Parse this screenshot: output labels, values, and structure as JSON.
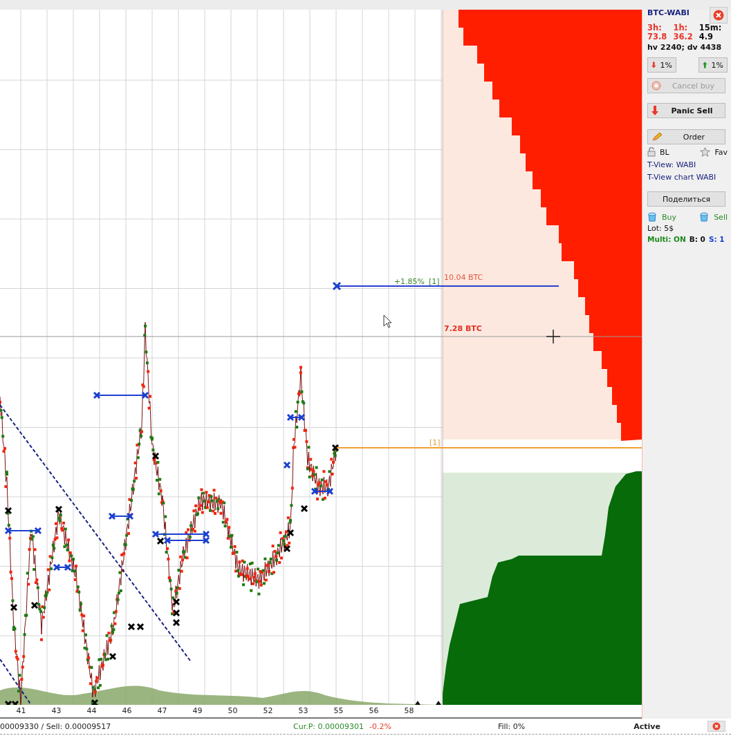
{
  "chart": {
    "x_labels": [
      "41",
      "43",
      "44",
      "46",
      "47",
      "49",
      "50",
      "52",
      "53",
      "55",
      "56",
      "58"
    ],
    "order_gain": "+1.85%",
    "order_count": "[1]",
    "sell_volume": "10.04 BTC",
    "cursor_volume": "7.28 BTC",
    "price_count": "[1]"
  },
  "panel": {
    "pair": "BTC-WABI",
    "stats": [
      {
        "period": "3h:",
        "value": "73.8",
        "color": "#e8332a"
      },
      {
        "period": "1h:",
        "value": "36.2",
        "color": "#e8332a"
      },
      {
        "period": "15m:",
        "value": "4.9",
        "color": "#111111"
      }
    ],
    "volumes": "hv 2240; dv 4438",
    "steps": [
      {
        "label": "1%",
        "kind": "down"
      },
      {
        "label": "1%",
        "kind": "up"
      }
    ],
    "cancel": {
      "label": "Cancel buy",
      "disabled": true
    },
    "panic": {
      "label": "Panic Sell"
    },
    "order": {
      "label": "Order"
    },
    "toggles": [
      {
        "label": "BL",
        "kind": "lock"
      },
      {
        "label": "Fav",
        "kind": "star"
      }
    ],
    "links": [
      "T-View: WABI",
      "T-View chart WABI"
    ],
    "share": "Поделиться",
    "trade": [
      {
        "label": "Buy"
      },
      {
        "label": "Sell"
      }
    ],
    "lot": "Lot: 5$",
    "flags": [
      {
        "text": "Multi: ON",
        "color": "#1e8a1e"
      },
      {
        "text": "B: 0",
        "color": "#111111"
      },
      {
        "text": "S: 1",
        "color": "#1a3fd0"
      }
    ]
  },
  "status": {
    "prices": "00009330 / Sell: 0.00009517",
    "current": "Cur.P: 0.00009301",
    "change": "-0.2%",
    "fill": "Fill: 0%",
    "state": "Active"
  }
}
